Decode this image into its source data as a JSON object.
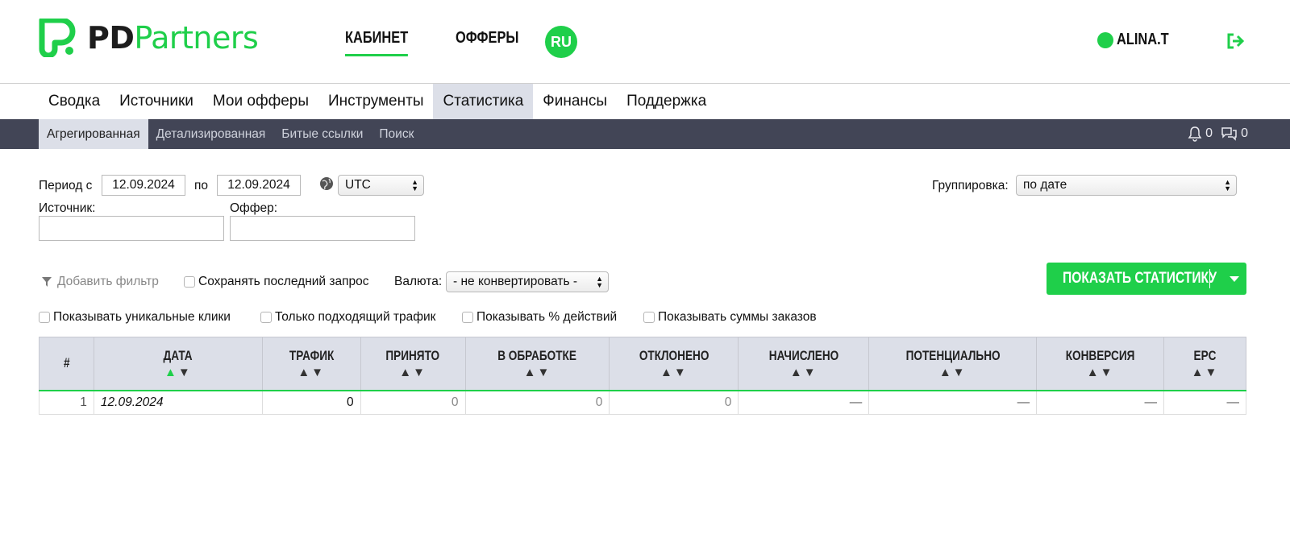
{
  "header": {
    "logo_pd": "PD",
    "logo_partners": "Partners",
    "nav": [
      "КАБИНЕТ",
      "ОФФЕРЫ"
    ],
    "lang": "RU",
    "user": "ALINA.T"
  },
  "main_nav": [
    "Сводка",
    "Источники",
    "Мои офферы",
    "Инструменты",
    "Статистика",
    "Финансы",
    "Поддержка"
  ],
  "sub_nav": [
    "Агрегированная",
    "Детализированная",
    "Битые ссылки",
    "Поиск"
  ],
  "notifications": {
    "bell_count": "0",
    "chat_count": "0"
  },
  "filters": {
    "period_from_label": "Период с",
    "period_from": "12.09.2024",
    "period_to_label": "по",
    "period_to": "12.09.2024",
    "timezone": "UTC",
    "grouping_label": "Группировка:",
    "grouping": "по дате",
    "source_label": "Источник:",
    "offer_label": "Оффер:",
    "add_filter": "Добавить фильтр",
    "save_last": "Сохранять последний запрос",
    "currency_label": "Валюта:",
    "currency": "- не конвертировать -",
    "show_button": "ПОКАЗАТЬ СТАТИСТИКУ",
    "checks": [
      "Показывать уникальные клики",
      "Только подходящий трафик",
      "Показывать % действий",
      "Показывать суммы заказов"
    ]
  },
  "table": {
    "columns": [
      "#",
      "ДАТА",
      "ТРАФИК",
      "ПРИНЯТО",
      "В ОБРАБОТКЕ",
      "ОТКЛОНЕНО",
      "НАЧИСЛЕНО",
      "ПОТЕНЦИАЛЬНО",
      "КОНВЕРСИЯ",
      "EPC"
    ],
    "rows": [
      [
        "1",
        "12.09.2024",
        "0",
        "0",
        "0",
        "0",
        "—",
        "—",
        "—",
        "—"
      ]
    ]
  },
  "colors": {
    "accent": "#1fcf4a",
    "subbar": "#424556",
    "active_tab": "#dcdfe8"
  }
}
